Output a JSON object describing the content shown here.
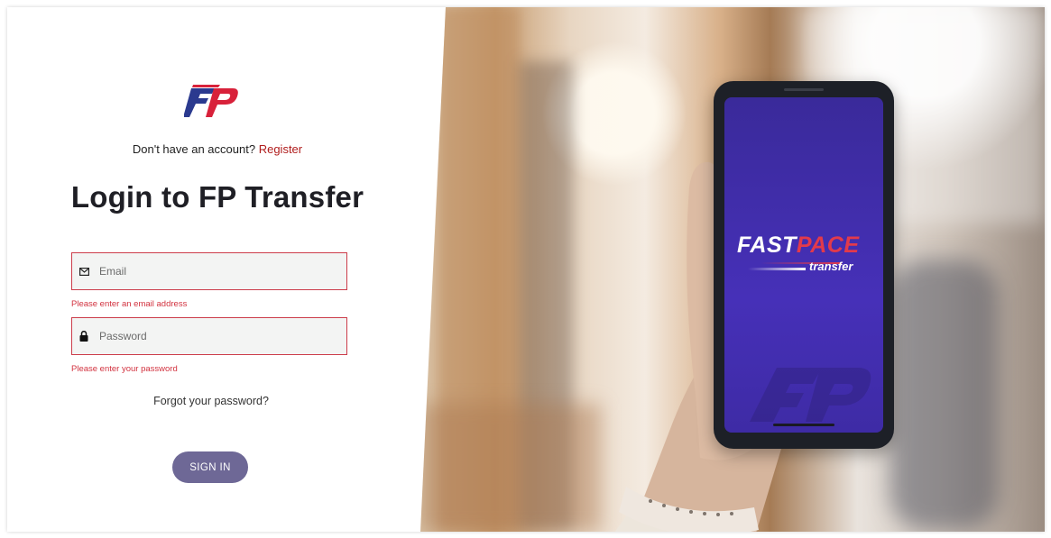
{
  "logo": {
    "text": "FP",
    "colors": {
      "primary": "#2b3a8f",
      "accent": "#d8213a"
    }
  },
  "register": {
    "prompt": "Don't have an account?",
    "link_label": "Register"
  },
  "title": "Login to FP Transfer",
  "form": {
    "email": {
      "placeholder": "Email",
      "value": "",
      "icon": "envelope-icon",
      "error": "Please enter an email address"
    },
    "password": {
      "placeholder": "Password",
      "value": "",
      "icon": "lock-icon",
      "error": "Please enter your password"
    },
    "forgot_label": "Forgot your password?",
    "signin_label": "SIGN IN"
  },
  "promo": {
    "brand_fast": "FAST",
    "brand_pace": "PACE",
    "brand_sub": "transfer"
  },
  "colors": {
    "error": "#d2323f",
    "button": "#6e6896",
    "link": "#b01c1c",
    "phone_screen": "#4630b8"
  }
}
